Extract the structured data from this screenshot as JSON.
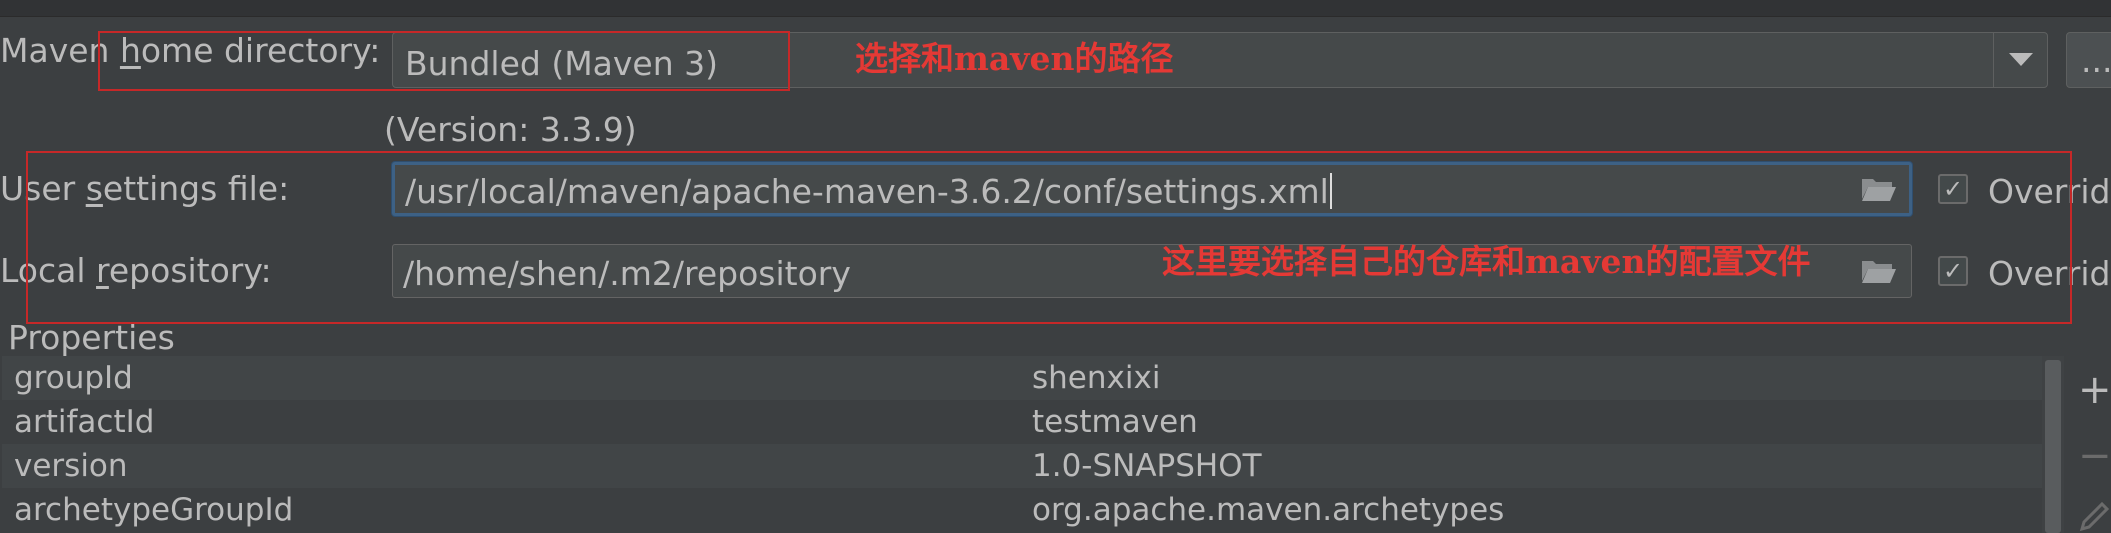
{
  "maven_home": {
    "label_prefix": "Maven ",
    "label_mnemonic": "h",
    "label_suffix": "ome directory:",
    "selected_value": "Bundled (Maven 3)",
    "browse_label": "...",
    "version_text": "(Version: 3.3.9)"
  },
  "user_settings": {
    "label_prefix": "User ",
    "label_mnemonic": "s",
    "label_suffix": "ettings file:",
    "value": "/usr/local/maven/apache-maven-3.6.2/conf/settings.xml",
    "override_label": "Overrid",
    "override_checked": true
  },
  "local_repository": {
    "label_prefix": "Local ",
    "label_mnemonic": "r",
    "label_suffix": "epository:",
    "value": "/home/shen/.m2/repository",
    "override_label": "Overrid",
    "override_checked": true
  },
  "properties": {
    "title": "Properties",
    "rows": [
      {
        "key": "groupId",
        "value": "shenxixi"
      },
      {
        "key": "artifactId",
        "value": "testmaven"
      },
      {
        "key": "version",
        "value": "1.0-SNAPSHOT"
      },
      {
        "key": "archetypeGroupId",
        "value": "org.apache.maven.archetypes"
      }
    ],
    "add_button": "+",
    "remove_button": "−"
  },
  "annotations": {
    "home_note": "选择和maven的路径",
    "settings_note": "这里要选择自己的仓库和maven的配置文件"
  },
  "icons": {
    "dropdown": "chevron-down-icon",
    "folder": "folder-open-icon",
    "check": "checkmark-icon",
    "edit": "pencil-icon"
  },
  "colors": {
    "background": "#3c3f41",
    "field": "#45494a",
    "focus_border": "#3d6185",
    "annotation_red": "#e53935"
  }
}
